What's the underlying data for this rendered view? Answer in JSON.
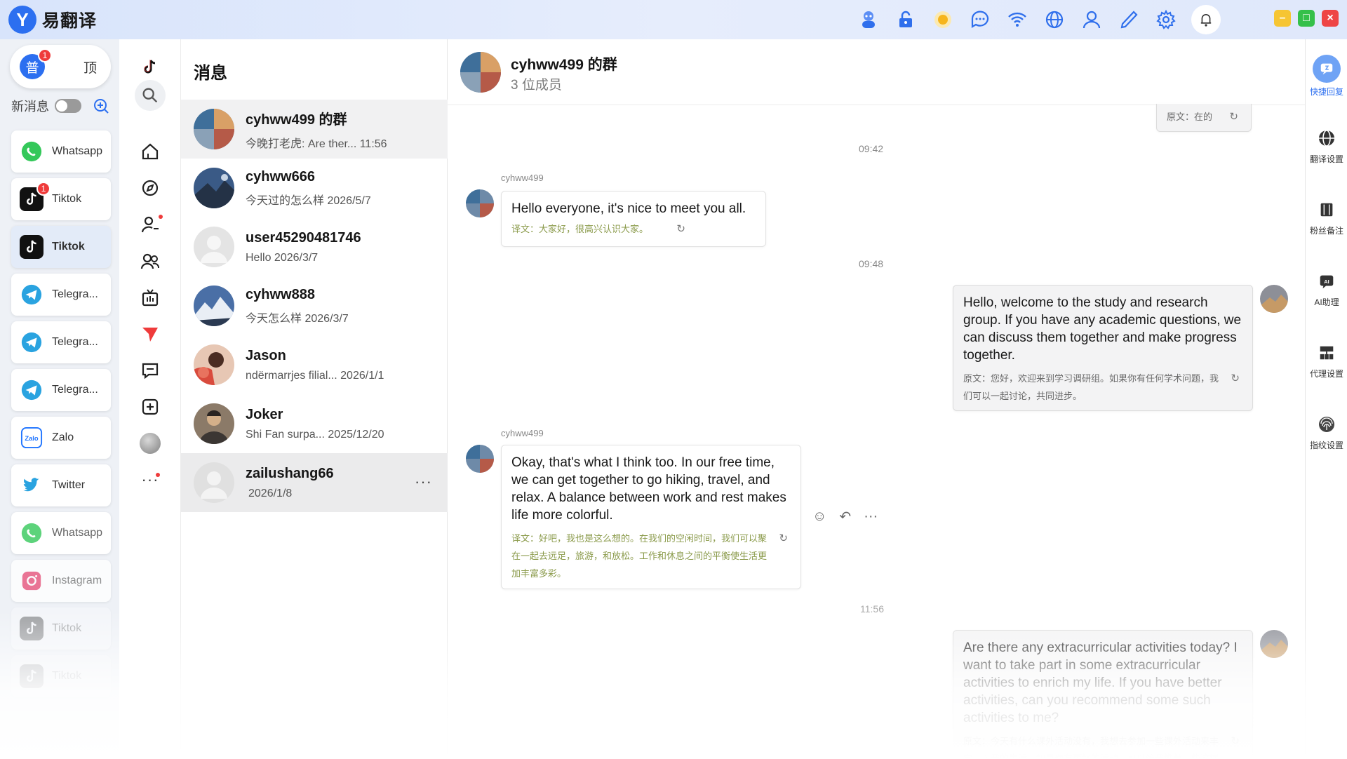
{
  "app": {
    "logo_letter": "Y",
    "title": "易翻译"
  },
  "titlebar_icons": [
    "robot-icon",
    "unlock-icon",
    "sun-icon",
    "chat-bubble-icon",
    "wifi-icon",
    "globe-icon",
    "user-icon",
    "phone-icon",
    "gear-icon",
    "bell-icon"
  ],
  "mode": {
    "normal_label": "普",
    "normal_badge": "1",
    "pin_label": "顶"
  },
  "new_message": {
    "label": "新消息"
  },
  "accounts": [
    {
      "label": "Whatsapp",
      "icon": "whatsapp-icon",
      "badge": ""
    },
    {
      "label": "Tiktok",
      "icon": "tiktok-icon",
      "badge": "1"
    },
    {
      "label": "Tiktok",
      "icon": "tiktok-icon",
      "badge": "",
      "active": true
    },
    {
      "label": "Telegra...",
      "icon": "telegram-icon",
      "badge": ""
    },
    {
      "label": "Telegra...",
      "icon": "telegram-icon",
      "badge": ""
    },
    {
      "label": "Telegra...",
      "icon": "telegram-icon",
      "badge": ""
    },
    {
      "label": "Zalo",
      "icon": "zalo-icon",
      "badge": ""
    },
    {
      "label": "Twitter",
      "icon": "twitter-icon",
      "badge": ""
    },
    {
      "label": "Whatsapp",
      "icon": "whatsapp-icon",
      "badge": ""
    },
    {
      "label": "Instagram",
      "icon": "instagram-icon",
      "badge": ""
    },
    {
      "label": "Tiktok",
      "icon": "tiktok-icon",
      "badge": ""
    },
    {
      "label": "Tiktok",
      "icon": "tiktok-icon",
      "badge": ""
    }
  ],
  "conversations": {
    "title": "消息",
    "items": [
      {
        "name": "cyhww499 的群",
        "preview": "今晚打老虎: Are ther...",
        "time": "11:56"
      },
      {
        "name": "cyhww666",
        "preview": "今天过的怎么样",
        "time": "2026/5/7"
      },
      {
        "name": "user45290481746",
        "preview": "Hello",
        "time": "2026/3/7"
      },
      {
        "name": "cyhww888",
        "preview": "今天怎么样",
        "time": "2026/3/7"
      },
      {
        "name": "Jason",
        "preview": "ndërmarrjes filial...",
        "time": "2026/1/1"
      },
      {
        "name": "Joker",
        "preview": "Shi Fan surpa...",
        "time": "2025/12/20"
      },
      {
        "name": "zailushang66",
        "preview": "",
        "time": "2026/1/8",
        "more": "···"
      }
    ]
  },
  "chat": {
    "name": "cyhww499 的群",
    "members": "3 位成员",
    "partial_original": "原文：在的",
    "times": [
      "09:42",
      "09:48",
      "11:56"
    ],
    "messages": [
      {
        "sender": "cyhww499",
        "text": "Hello everyone, it's nice to meet you all.",
        "translation": "译文：大家好，很高兴认识大家。"
      },
      {
        "text": "Hello, welcome to the study and research group. If you have any academic questions, we can discuss them together and make progress together.",
        "original": "原文：您好，欢迎来到学习调研组。如果你有任何学术问题，我们可以一起讨论，共同进步。"
      },
      {
        "sender": "cyhww499",
        "text": "Okay, that's what I think too. In our free time, we can get together to go hiking, travel, and relax. A balance between work and rest makes life more colorful.",
        "translation": "译文：好吧，我也是这么想的。在我们的空闲时间，我们可以聚在一起去远足，旅游，和放松。工作和休息之间的平衡使生活更加丰富多彩。"
      },
      {
        "text": "Are there any extracurricular activities today? I want to take part in some extracurricular activities to enrich my life. If you have better activities, can you recommend some such activities to me?",
        "original": "原文：今天有什么课外活动没有，我想去参加一些课外活动来丰富一下我的生活，如果你有更好的活动，可以给我推荐一些这样的活动吗？"
      }
    ]
  },
  "tools": [
    {
      "label": "快捷回复",
      "icon": "quick-reply-icon",
      "active": true
    },
    {
      "label": "翻译设置",
      "icon": "globe-icon"
    },
    {
      "label": "粉丝备注",
      "icon": "notes-icon"
    },
    {
      "label": "AI助理",
      "icon": "ai-icon"
    },
    {
      "label": "代理设置",
      "icon": "proxy-icon"
    },
    {
      "label": "指纹设置",
      "icon": "fingerprint-icon"
    }
  ],
  "colors": {
    "accent": "#2c6ff0",
    "badge": "#ef3b3b",
    "translation": "#8a9a4a"
  }
}
